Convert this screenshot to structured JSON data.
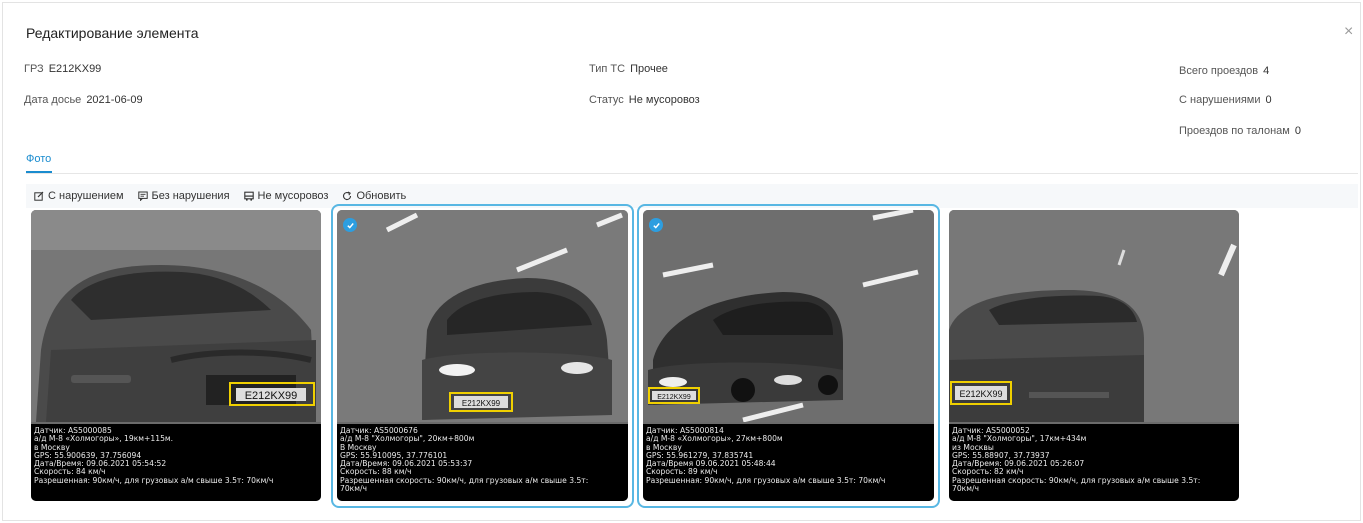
{
  "modal": {
    "title": "Редактирование элемента",
    "close_glyph": "×"
  },
  "fields": {
    "grz": {
      "label": "ГРЗ",
      "value": "E212KX99"
    },
    "dossier_date": {
      "label": "Дата досье",
      "value": "2021-06-09"
    },
    "vehicle_type": {
      "label": "Тип ТС",
      "value": "Прочее"
    },
    "status": {
      "label": "Статус",
      "value": "Не мусоровоз"
    },
    "total_passes": {
      "label": "Всего проездов",
      "value": "4"
    },
    "with_violations": {
      "label": "С нарушениями",
      "value": "0"
    },
    "coupon_passes": {
      "label": "Проездов по талонам",
      "value": "0"
    }
  },
  "tabs": [
    {
      "label": "Фото",
      "active": true
    }
  ],
  "toolbar": {
    "with_violation": {
      "label": "С нарушением",
      "icon": "edit-icon"
    },
    "without_violation": {
      "label": "Без нарушения",
      "icon": "message-icon"
    },
    "not_garbage_truck": {
      "label": "Не мусоровоз",
      "icon": "truck-icon"
    },
    "refresh": {
      "label": "Обновить",
      "icon": "refresh-icon"
    }
  },
  "photos": [
    {
      "selected": false,
      "plate": "E212KX99",
      "caption": [
        "Датчик: AS5000085",
        "а/д М-8 «Холмогоры», 19км+115м.",
        "в Москву",
        "GPS: 55.900639, 37.756094",
        "Дата/Время: 09.06.2021 05:54:52",
        "Скорость: 84 км/ч",
        "Разрешенная: 90км/ч, для грузовых а/м свыше 3.5т: 70км/ч"
      ]
    },
    {
      "selected": true,
      "plate": "E212KX99",
      "caption": [
        "Датчик: AS5000676",
        "а/д М-8 \"Холмогоры\", 20км+800м",
        "В Москву",
        "GPS: 55.910095, 37.776101",
        "Дата/Время: 09.06.2021 05:53:37",
        "Скорость: 88 км/ч",
        "Разрешенная скорость: 90км/ч, для грузовых а/м свыше 3.5т:",
        "70км/ч"
      ]
    },
    {
      "selected": true,
      "plate": "E212KX99",
      "caption": [
        "Датчик: AS5000814",
        "а/д М-8 «Холмогоры», 27км+800м",
        "в Москву",
        "GPS: 55.961279, 37.835741",
        "Дата/Время 09.06.2021 05:48:44",
        "Скорость: 89 км/ч",
        "Разрешенная: 90км/ч, для грузовых а/м свыше 3.5т: 70км/ч"
      ]
    },
    {
      "selected": false,
      "plate": "E212KX99",
      "caption": [
        "Датчик: AS5000052",
        "а/д М-8 \"Холмогоры\", 17км+434м",
        "из Москвы",
        "GPS: 55.88907, 37.73937",
        "Дата/Время: 09.06.2021 05:26:07",
        "Скорость: 82 км/ч",
        "Разрешенная скорость: 90км/ч, для грузовых а/м свыше 3.5т:",
        "70км/ч"
      ]
    }
  ]
}
